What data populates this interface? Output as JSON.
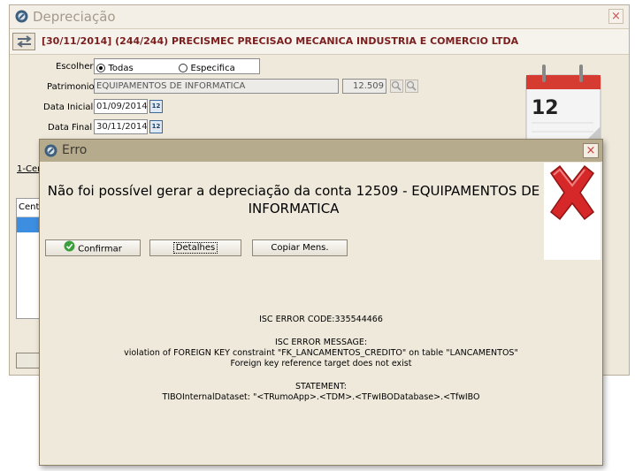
{
  "main_window": {
    "title": "Depreciação",
    "close_label": "×",
    "header": "[30/11/2014] (244/244) PRECISMEC PRECISAO MECANICA INDUSTRIA E COMERCIO LTDA",
    "form": {
      "escolher_label": "Escolher",
      "option_todas": "Todas",
      "option_especifica": "Especifica",
      "selected_option": "Todas",
      "patrimonio_label": "Patrimonio",
      "patrimonio_value": "EQUIPAMENTOS DE INFORMATICA",
      "patrimonio_code": "12.509",
      "data_inicial_label": "Data Inicial",
      "data_inicial_value": "01/09/2014",
      "data_final_label": "Data Final",
      "data_final_value": "30/11/2014",
      "calendar_day": "12"
    },
    "tab_partial": "1-Cer",
    "grid_header_partial": "Cent",
    "calendar_graphic_day": "12"
  },
  "error_dialog": {
    "title": "Erro",
    "close_label": "×",
    "message": "Não foi possível gerar a depreciação da conta 12509 - EQUIPAMENTOS DE INFORMATICA",
    "buttons": {
      "confirm": "Confirmar",
      "details": "Detalhes",
      "copy": "Copiar Mens."
    },
    "details": {
      "code_line": "ISC ERROR CODE:335544466",
      "message_title": "ISC ERROR MESSAGE:",
      "message_line1": "violation of FOREIGN KEY constraint \"FK_LANCAMENTOS_CREDITO\" on table \"LANCAMENTOS\"",
      "message_line2": "Foreign key reference target does not exist",
      "statement_title": "STATEMENT:",
      "statement_line": "TIBOInternalDataset: \"<TRumoApp>.<TDM>.<TFwIBODatabase>.<TfwIBO"
    }
  },
  "colors": {
    "header_text": "#7a1e1e",
    "dialog_titlebar": "#b7ab8e",
    "window_bg": "#efe9dc",
    "error_x": "#d62828",
    "confirm_icon": "#3ba03b"
  },
  "icons": [
    "app-icon",
    "arrows-nav-icon",
    "search-icon",
    "calendar-icon",
    "calendar-graphic-icon",
    "error-x-icon",
    "check-icon",
    "close-icon"
  ]
}
